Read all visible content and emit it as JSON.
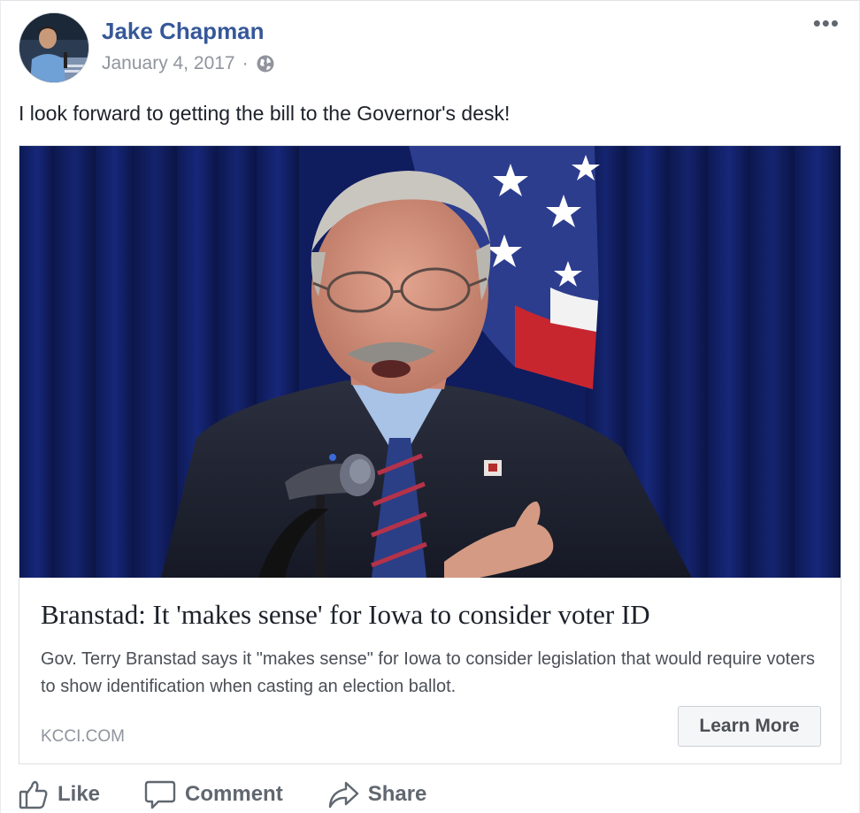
{
  "post": {
    "author": "Jake Chapman",
    "date": "January 4, 2017",
    "separator": "·",
    "privacy_icon": "globe-icon",
    "more_label": "•••",
    "message": "I look forward to getting the bill to the Governor's desk!"
  },
  "link_card": {
    "title": "Branstad: It 'makes sense' for Iowa to consider voter ID",
    "description": "Gov. Terry Branstad says it \"makes sense\" for Iowa to consider legislation that would require voters to show identification when casting an election ballot.",
    "domain": "KCCI.COM",
    "cta_label": "Learn More"
  },
  "actions": {
    "like": {
      "label": "Like",
      "icon": "thumbs-up-icon"
    },
    "comment": {
      "label": "Comment",
      "icon": "speech-bubble-icon"
    },
    "share": {
      "label": "Share",
      "icon": "share-arrow-icon"
    }
  },
  "colors": {
    "author_link": "#365899",
    "meta_text": "#90949c",
    "action_text": "#606770"
  }
}
